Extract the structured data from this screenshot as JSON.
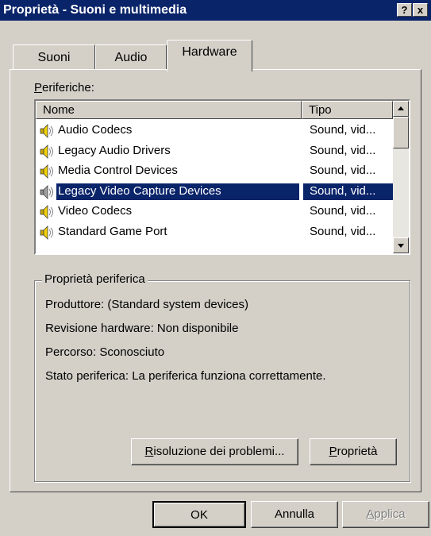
{
  "window": {
    "title": "Proprietà - Suoni e multimedia",
    "help_glyph": "?",
    "close_glyph": "x"
  },
  "tabs": [
    {
      "label": "Suoni",
      "active": false
    },
    {
      "label": "Audio",
      "active": false
    },
    {
      "label": "Hardware",
      "active": true
    }
  ],
  "devices": {
    "label_underline": "P",
    "label_rest": "eriferiche:",
    "columns": {
      "name": "Nome",
      "type": "Tipo"
    },
    "rows": [
      {
        "name": "Audio Codecs",
        "type": "Sound, vid...",
        "selected": false,
        "icon": "speaker-icon"
      },
      {
        "name": "Legacy Audio Drivers",
        "type": "Sound, vid...",
        "selected": false,
        "icon": "speaker-icon"
      },
      {
        "name": "Media Control Devices",
        "type": "Sound, vid...",
        "selected": false,
        "icon": "speaker-icon"
      },
      {
        "name": "Legacy Video Capture Devices",
        "type": "Sound, vid...",
        "selected": true,
        "icon": "speaker-icon"
      },
      {
        "name": "Video Codecs",
        "type": "Sound, vid...",
        "selected": false,
        "icon": "speaker-icon"
      },
      {
        "name": "Standard Game Port",
        "type": "Sound, vid...",
        "selected": false,
        "icon": "speaker-icon"
      }
    ]
  },
  "properties": {
    "title": "Proprietà periferica",
    "manufacturer": "Produttore: (Standard system devices)",
    "revision": "Revisione hardware: Non disponibile",
    "location": "Percorso: Sconosciuto",
    "status": "Stato periferica: La periferica funziona correttamente.",
    "troubleshoot_underline": "R",
    "troubleshoot_rest": "isoluzione dei problemi...",
    "props_underline": "P",
    "props_rest": "roprietà"
  },
  "footer": {
    "ok": "OK",
    "cancel": "Annulla",
    "apply_underline": "A",
    "apply_rest": "pplica"
  },
  "colors": {
    "selection": "#0a246a",
    "face": "#d4d0c8",
    "titlebar": "#0a246a"
  }
}
